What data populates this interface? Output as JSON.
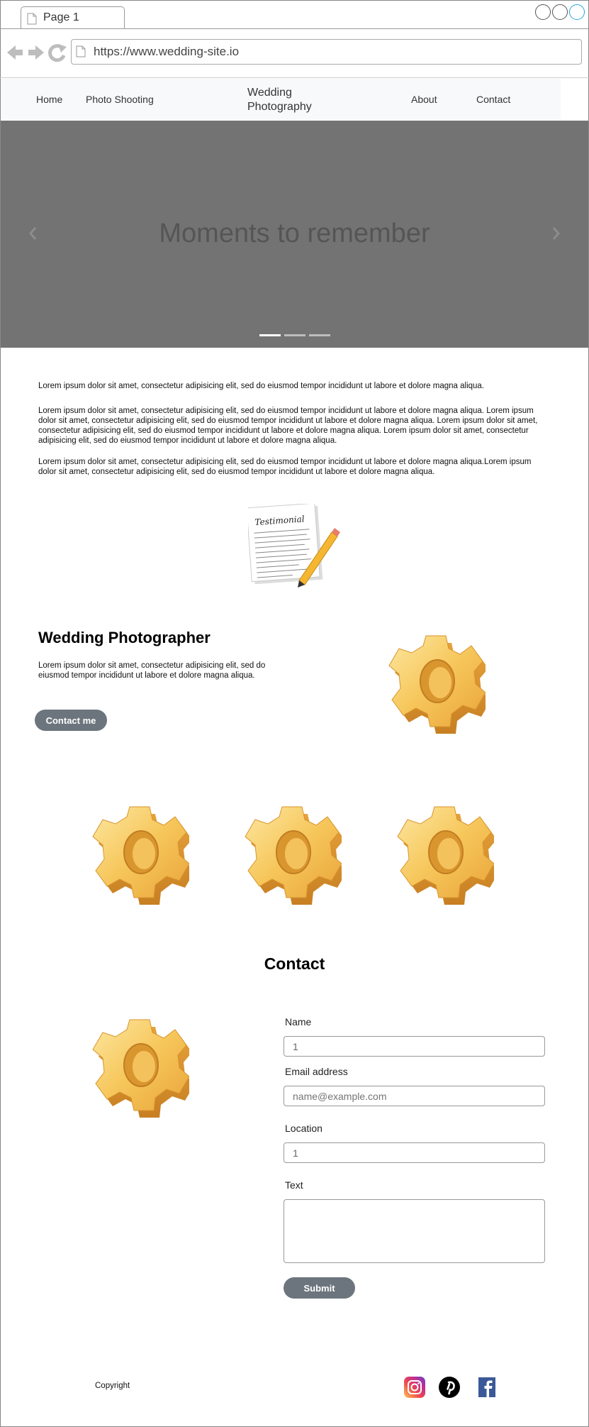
{
  "browser": {
    "tab_title": "Page 1",
    "url": "https://www.wedding-site.io"
  },
  "nav": {
    "home": "Home",
    "photo_shooting": "Photo Shooting",
    "brand_line1": "Wedding",
    "brand_line2": "Photography",
    "about": "About",
    "contact": "Contact"
  },
  "hero": {
    "title": "Moments to remember",
    "slides": 3,
    "active_slide": 1
  },
  "intro": {
    "p1": "Lorem ipsum dolor sit amet, consectetur adipisicing elit, sed do eiusmod tempor incididunt ut labore et dolore magna aliqua.",
    "p2": "Lorem ipsum dolor sit amet, consectetur adipisicing elit, sed do eiusmod tempor incididunt ut labore et dolore magna aliqua. Lorem ipsum dolor sit amet, consectetur adipisicing elit, sed do eiusmod tempor incididunt ut labore et dolore magna aliqua. Lorem ipsum dolor sit amet, consectetur adipisicing elit, sed do eiusmod tempor incididunt ut labore et dolore magna aliqua. Lorem ipsum dolor sit amet, consectetur adipisicing elit, sed do eiusmod tempor incididunt ut labore et dolore magna aliqua.",
    "p3": "Lorem ipsum dolor sit amet, consectetur adipisicing elit, sed do eiusmod tempor incididunt ut labore et dolore magna aliqua.Lorem ipsum dolor sit amet, consectetur adipisicing elit, sed do eiusmod tempor incididunt ut labore et dolore magna aliqua."
  },
  "testimonial": {
    "heading": "Testimonial"
  },
  "photographer": {
    "title": "Wedding Photographer",
    "text": "Lorem ipsum dolor sit amet, consectetur adipisicing elit, sed do eiusmod tempor incididunt ut labore et dolore magna aliqua.",
    "button": "Contact me"
  },
  "contact": {
    "title": "Contact",
    "name_label": "Name",
    "name_value": "1",
    "email_label": "Email address",
    "email_placeholder": "name@example.com",
    "location_label": "Location",
    "location_value": "1",
    "text_label": "Text",
    "submit": "Submit"
  },
  "footer": {
    "copyright": "Copyright",
    "icons": [
      "instagram-icon",
      "pinterest-icon",
      "facebook-icon"
    ]
  },
  "colors": {
    "hero_bg": "#737373",
    "button_bg": "#6c757d",
    "nav_bg": "#f8f9fa",
    "gear": "#f2b84b"
  }
}
